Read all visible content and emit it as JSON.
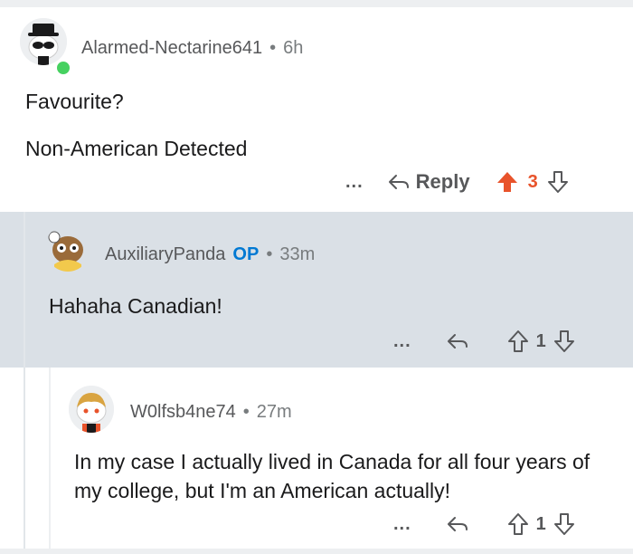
{
  "comments": [
    {
      "username": "Alarmed-Nectarine641",
      "time": "6h",
      "paragraphs": [
        "Favourite?",
        "Non-American Detected"
      ],
      "more": "...",
      "reply_label": "Reply",
      "score": "3",
      "upvoted": true,
      "online": true
    },
    {
      "username": "AuxiliaryPanda",
      "badge": "OP",
      "time": "33m",
      "paragraphs": [
        "Hahaha Canadian!"
      ],
      "more": "...",
      "score": "1"
    },
    {
      "username": "W0lfsb4ne74",
      "time": "27m",
      "paragraphs": [
        "In my case I actually lived in Canada for all four years of my college, but I'm an American actually!"
      ],
      "more": "...",
      "score": "1"
    }
  ],
  "separator": "•",
  "colors": {
    "upvote": "#e8532b",
    "op_badge": "#0079d3",
    "highlight_bg": "#dae0e6",
    "online_dot": "#46d160"
  }
}
